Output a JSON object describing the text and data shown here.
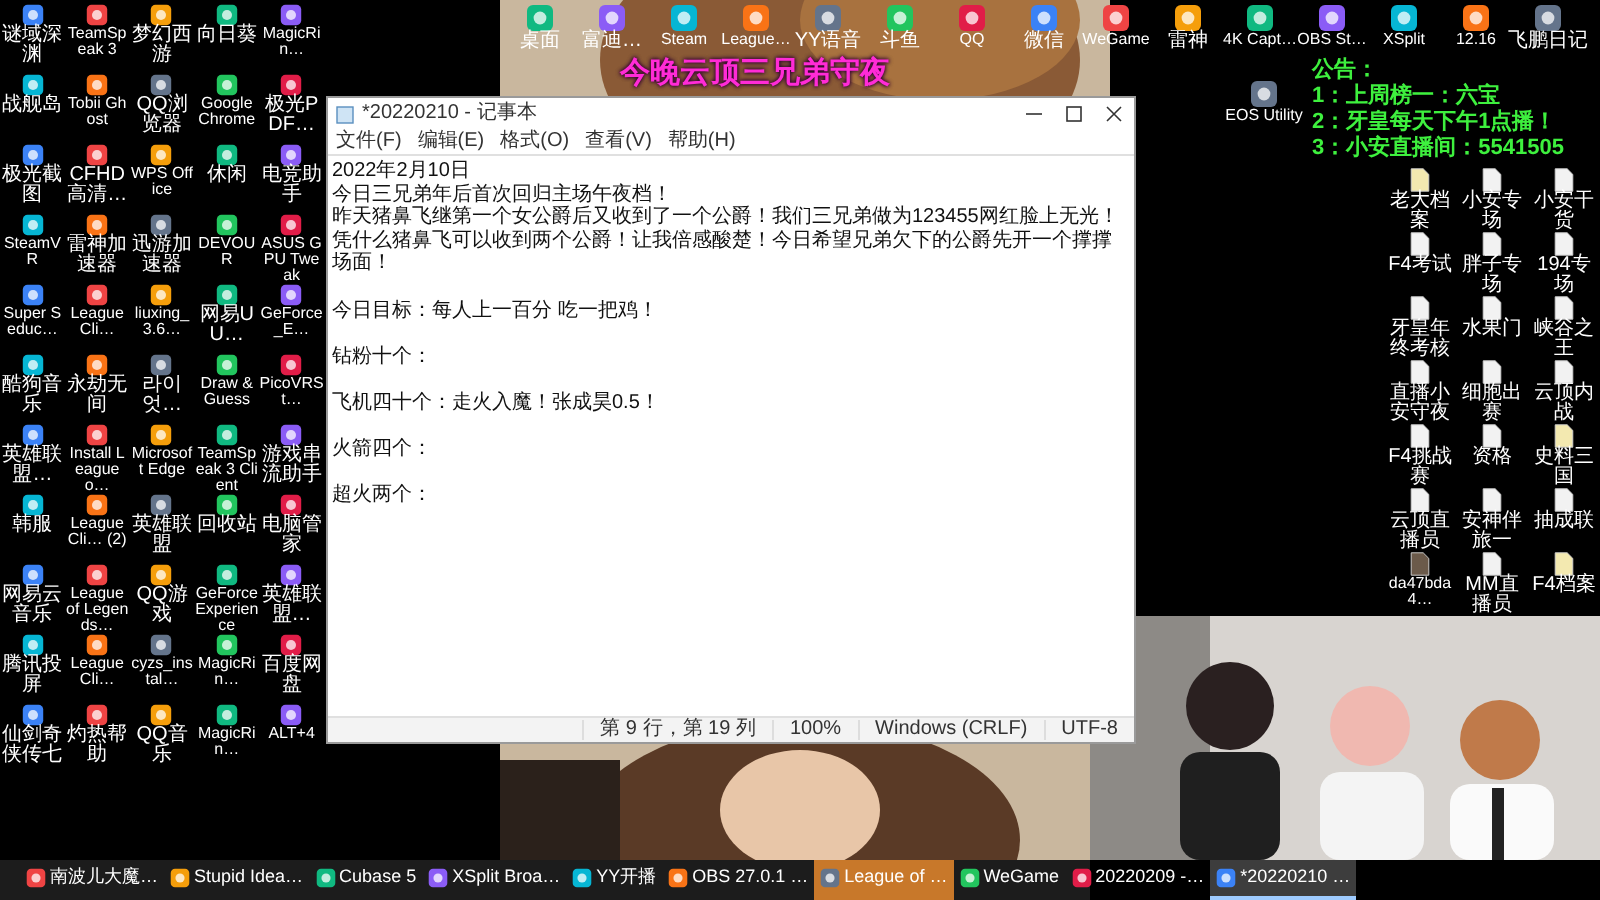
{
  "left_icons": [
    {
      "label": "谜域深渊"
    },
    {
      "label": "TeamSpeak 3"
    },
    {
      "label": "梦幻西游"
    },
    {
      "label": "向日葵"
    },
    {
      "label": "MagicRin…"
    },
    {
      "label": "战舰岛"
    },
    {
      "label": "Tobii Ghost"
    },
    {
      "label": "QQ浏览器"
    },
    {
      "label": "Google Chrome"
    },
    {
      "label": "极光PDF…"
    },
    {
      "label": "极光截图"
    },
    {
      "label": "CFHD高清…"
    },
    {
      "label": "WPS Office"
    },
    {
      "label": "休闲"
    },
    {
      "label": "电竞助手"
    },
    {
      "label": "SteamVR"
    },
    {
      "label": "雷神加速器"
    },
    {
      "label": "迅游加速器"
    },
    {
      "label": "DEVOUR"
    },
    {
      "label": "ASUS GPU Tweak"
    },
    {
      "label": "Super Seduc…"
    },
    {
      "label": "LeagueCli…"
    },
    {
      "label": "liuxing_3.6…"
    },
    {
      "label": "网易UU…"
    },
    {
      "label": "GeForce_E…"
    },
    {
      "label": "酷狗音乐"
    },
    {
      "label": "永劫无间"
    },
    {
      "label": "라이엇…"
    },
    {
      "label": "Draw & Guess"
    },
    {
      "label": "PicoVRSt…"
    },
    {
      "label": "英雄联盟…"
    },
    {
      "label": "Install League o…"
    },
    {
      "label": "Microsoft Edge"
    },
    {
      "label": "TeamSpeak 3 Client"
    },
    {
      "label": "游戏串流助手"
    },
    {
      "label": "韩服"
    },
    {
      "label": "LeagueCli… (2)"
    },
    {
      "label": "英雄联盟"
    },
    {
      "label": "回收站"
    },
    {
      "label": "电脑管家"
    },
    {
      "label": "网易云音乐"
    },
    {
      "label": "League of Legends…"
    },
    {
      "label": "QQ游戏"
    },
    {
      "label": "GeForce Experience"
    },
    {
      "label": "英雄联盟…"
    },
    {
      "label": "腾讯投屏"
    },
    {
      "label": "LeagueCli…"
    },
    {
      "label": "cyzs_instal…"
    },
    {
      "label": "MagicRin…"
    },
    {
      "label": "百度网盘"
    },
    {
      "label": "仙剑奇侠传七"
    },
    {
      "label": "灼热帮助"
    },
    {
      "label": "QQ音乐"
    },
    {
      "label": "MagicRin…"
    },
    {
      "label": "ALT+4"
    }
  ],
  "top_icons": [
    {
      "label": "桌面"
    },
    {
      "label": "富迪…"
    },
    {
      "label": "Steam"
    },
    {
      "label": "League…"
    },
    {
      "label": "YY语音"
    },
    {
      "label": "斗鱼"
    },
    {
      "label": "QQ"
    },
    {
      "label": "微信"
    },
    {
      "label": "WeGame"
    },
    {
      "label": "雷神"
    },
    {
      "label": "4K Capt…"
    },
    {
      "label": "OBS St…"
    },
    {
      "label": "XSplit"
    },
    {
      "label": "12.16"
    },
    {
      "label": "飞鹏日记"
    }
  ],
  "eos_icon": {
    "label": "EOS Utility"
  },
  "right_icons": [
    {
      "label": "老大档案",
      "kind": "folder"
    },
    {
      "label": "小安专场",
      "kind": "file"
    },
    {
      "label": "小安干货",
      "kind": "file"
    },
    {
      "label": "F4考试",
      "kind": "file"
    },
    {
      "label": "胖子专场",
      "kind": "file"
    },
    {
      "label": "194专场",
      "kind": "file"
    },
    {
      "label": "牙皇年终考核",
      "kind": "file"
    },
    {
      "label": "水果门",
      "kind": "file"
    },
    {
      "label": "峡谷之王",
      "kind": "file"
    },
    {
      "label": "直播小安守夜",
      "kind": "file"
    },
    {
      "label": "细胞出赛",
      "kind": "file"
    },
    {
      "label": "云顶内战",
      "kind": "file"
    },
    {
      "label": "F4挑战赛",
      "kind": "file"
    },
    {
      "label": "资格",
      "kind": "file"
    },
    {
      "label": "史料三国",
      "kind": "folder"
    },
    {
      "label": "云顶直播员",
      "kind": "file"
    },
    {
      "label": "安神伴旅一",
      "kind": "file"
    },
    {
      "label": "抽成联",
      "kind": "file"
    },
    {
      "label": "da47bda4…"
    },
    {
      "label": "MM直播员",
      "kind": "file"
    },
    {
      "label": "F4档案",
      "kind": "folder"
    }
  ],
  "overlay_title": "今晚云顶三兄弟守夜",
  "announcement": {
    "heading": "公告：",
    "lines": [
      "1：上周榜一：六宝",
      "2：牙皇每天下午1点播！",
      "3：小安直播间：5541505"
    ]
  },
  "notepad": {
    "title": "*20220210 - 记事本",
    "menu": [
      "文件(F)",
      "编辑(E)",
      "格式(O)",
      "查看(V)",
      "帮助(H)"
    ],
    "paragraphs": [
      [
        "2022年2月10日",
        "今日三兄弟年后首次回归主场午夜档！",
        "昨天猪鼻飞继第一个女公爵后又收到了一个公爵！我们三兄弟做为123455网红脸上无光！凭什么猪鼻飞可以收到两个公爵！让我倍感酸楚！今日希望兄弟欠下的公爵先开一个撑撑场面！"
      ],
      [
        "今日目标：每人上一百分 吃一把鸡！"
      ],
      [
        "钻粉十个："
      ],
      [
        "飞机四十个：走火入魔！张成昊0.5！"
      ],
      [
        "火箭四个："
      ],
      [
        "超火两个："
      ]
    ],
    "status": [
      "第 9 行，第 19 列",
      "100%",
      "Windows (CRLF)",
      "UTF-8"
    ]
  },
  "taskbar": [
    {
      "label": "南波儿大魔…",
      "selected": false,
      "active": false
    },
    {
      "label": "Stupid Idea…",
      "selected": false,
      "active": false
    },
    {
      "label": "Cubase 5",
      "selected": false,
      "active": false
    },
    {
      "label": "XSplit Broa…",
      "selected": false,
      "active": false
    },
    {
      "label": "YY开播",
      "selected": false,
      "active": false
    },
    {
      "label": "OBS 27.0.1 …",
      "selected": false,
      "active": false
    },
    {
      "label": "League of …",
      "selected": true,
      "active": false
    },
    {
      "label": "WeGame",
      "selected": false,
      "active": false
    },
    {
      "label": "20220209 -…",
      "selected": false,
      "active": false
    },
    {
      "label": "*20220210 …",
      "selected": false,
      "active": true
    }
  ]
}
